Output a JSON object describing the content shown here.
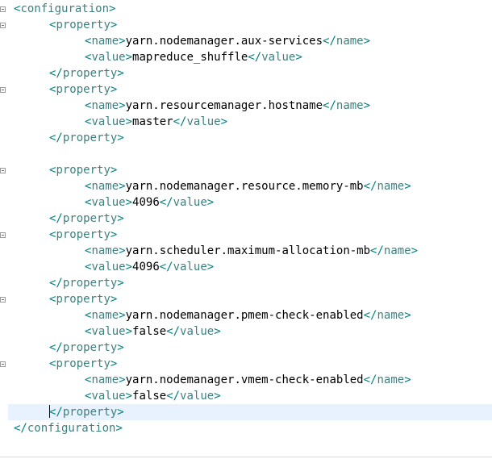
{
  "editor": {
    "lines": [
      {
        "indent": 0,
        "kind": "open",
        "tag": "configuration"
      },
      {
        "indent": 1,
        "kind": "open",
        "tag": "property"
      },
      {
        "indent": 2,
        "kind": "elem",
        "tag": "name",
        "text": "yarn.nodemanager.aux-services"
      },
      {
        "indent": 2,
        "kind": "elem",
        "tag": "value",
        "text": "mapreduce_shuffle"
      },
      {
        "indent": 1,
        "kind": "close",
        "tag": "property"
      },
      {
        "indent": 1,
        "kind": "open",
        "tag": "property"
      },
      {
        "indent": 2,
        "kind": "elem",
        "tag": "name",
        "text": "yarn.resourcemanager.hostname"
      },
      {
        "indent": 2,
        "kind": "elem",
        "tag": "value",
        "text": "master"
      },
      {
        "indent": 1,
        "kind": "close",
        "tag": "property"
      },
      {
        "indent": 0,
        "kind": "blank"
      },
      {
        "indent": 1,
        "kind": "open",
        "tag": "property"
      },
      {
        "indent": 2,
        "kind": "elem",
        "tag": "name",
        "text": "yarn.nodemanager.resource.memory-mb"
      },
      {
        "indent": 2,
        "kind": "elem",
        "tag": "value",
        "text": "4096"
      },
      {
        "indent": 1,
        "kind": "close",
        "tag": "property"
      },
      {
        "indent": 1,
        "kind": "open",
        "tag": "property"
      },
      {
        "indent": 2,
        "kind": "elem",
        "tag": "name",
        "text": "yarn.scheduler.maximum-allocation-mb"
      },
      {
        "indent": 2,
        "kind": "elem",
        "tag": "value",
        "text": "4096"
      },
      {
        "indent": 1,
        "kind": "close",
        "tag": "property"
      },
      {
        "indent": 1,
        "kind": "open",
        "tag": "property"
      },
      {
        "indent": 2,
        "kind": "elem",
        "tag": "name",
        "text": "yarn.nodemanager.pmem-check-enabled"
      },
      {
        "indent": 2,
        "kind": "elem",
        "tag": "value",
        "text": "false"
      },
      {
        "indent": 1,
        "kind": "close",
        "tag": "property"
      },
      {
        "indent": 1,
        "kind": "open",
        "tag": "property"
      },
      {
        "indent": 2,
        "kind": "elem",
        "tag": "name",
        "text": "yarn.nodemanager.vmem-check-enabled"
      },
      {
        "indent": 2,
        "kind": "elem",
        "tag": "value",
        "text": "false"
      },
      {
        "indent": 1,
        "kind": "close",
        "tag": "property",
        "current": true,
        "caret": true
      },
      {
        "indent": 0,
        "kind": "close",
        "tag": "configuration"
      }
    ]
  },
  "colors": {
    "bracket": "#008080",
    "tag": "#3f7f7f",
    "text": "#000000",
    "current_line": "#e8f2fe"
  }
}
